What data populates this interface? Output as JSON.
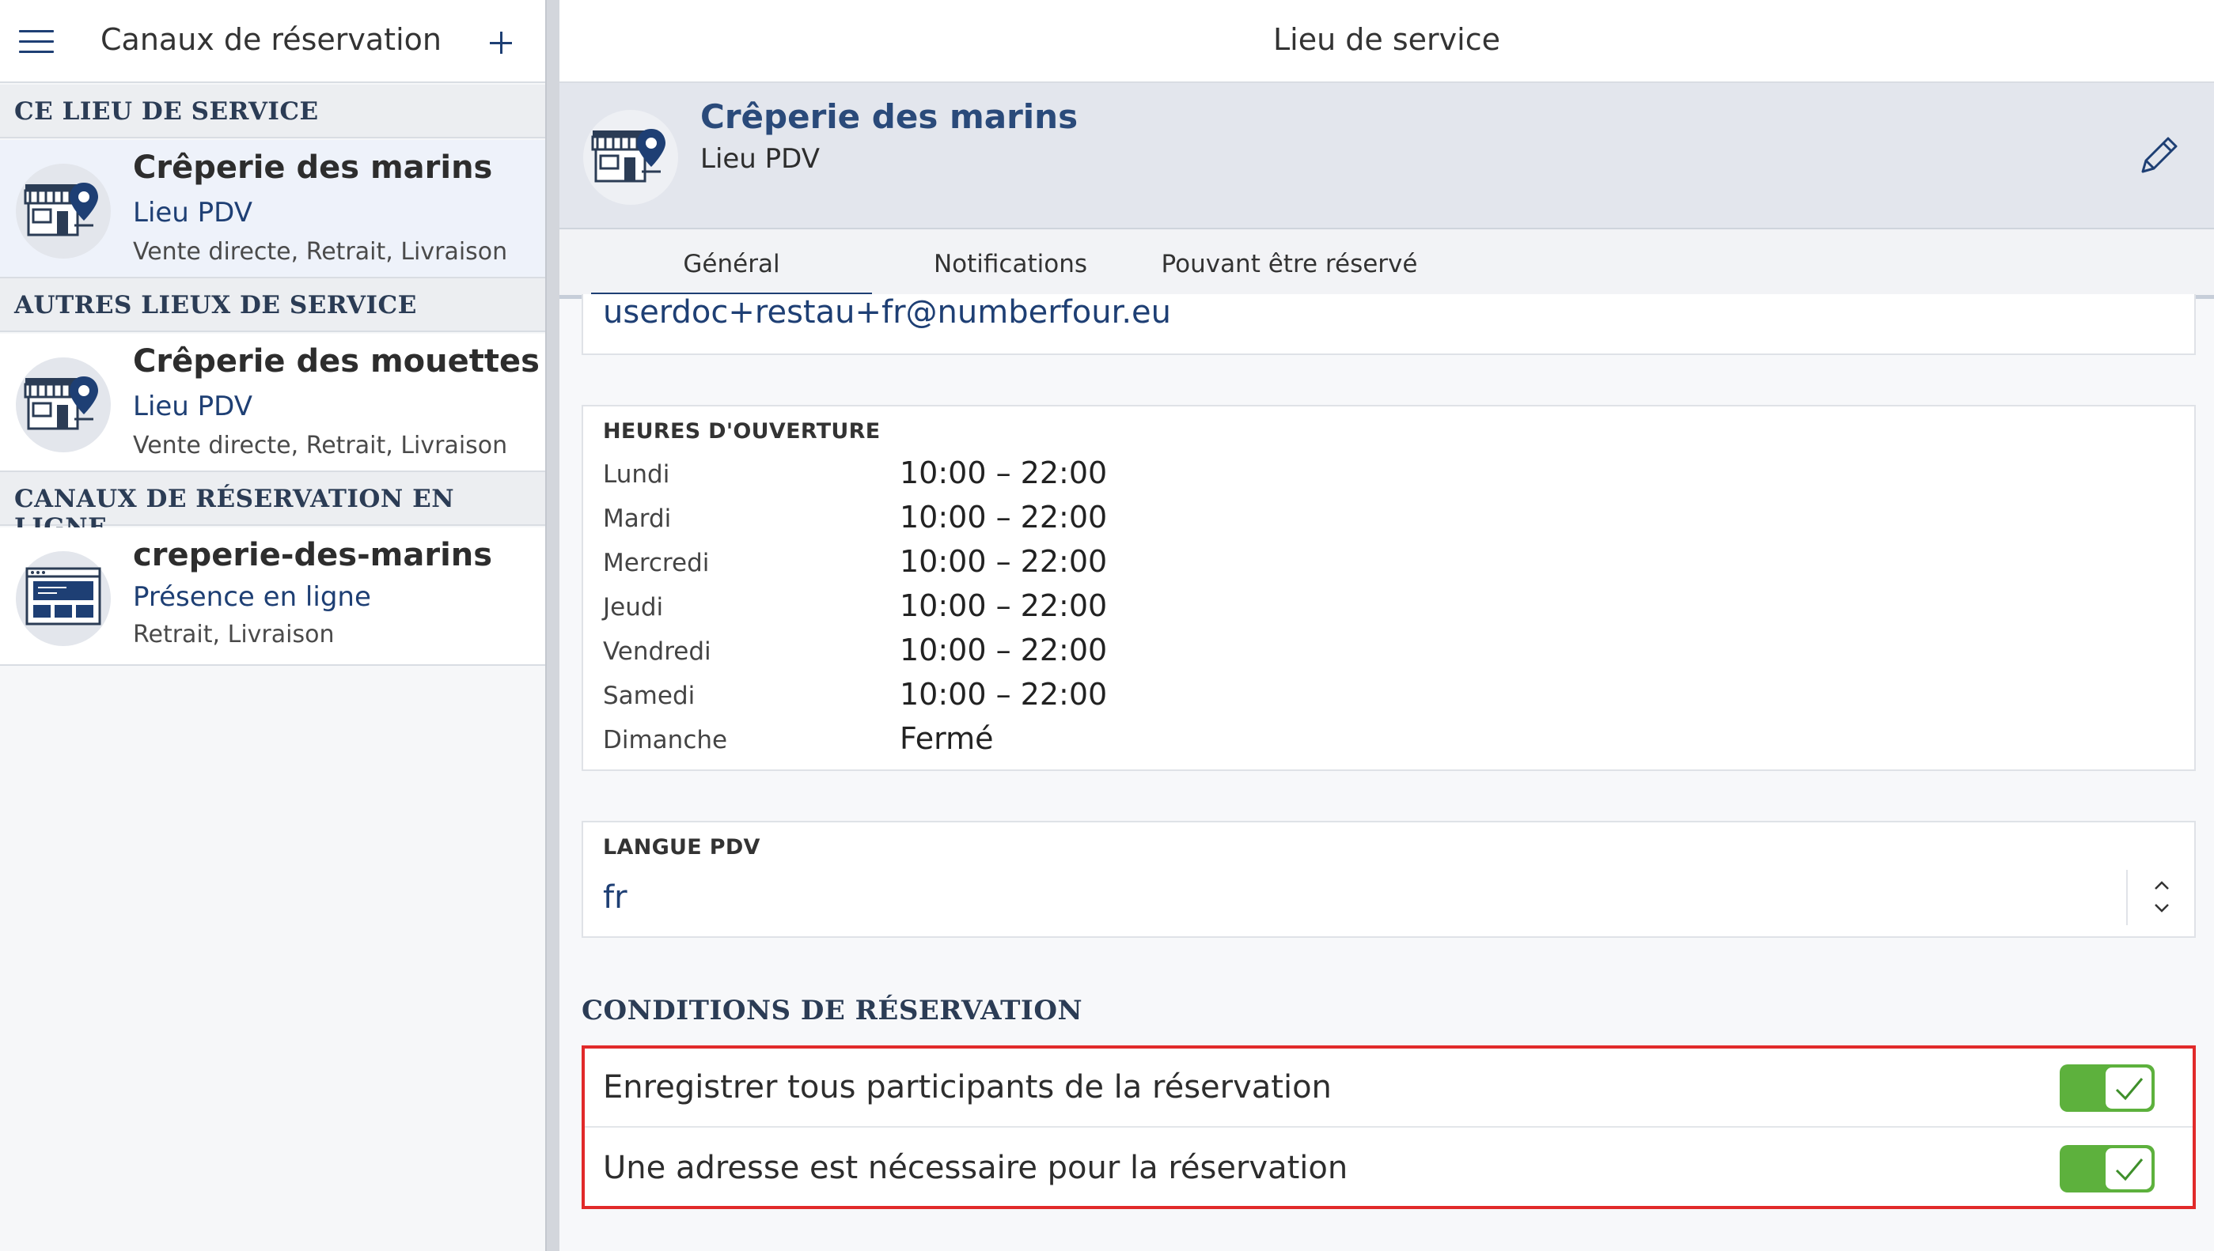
{
  "left_pane": {
    "title": "Canaux de réservation",
    "sections": [
      {
        "heading": "CE LIEU DE SERVICE",
        "items": [
          {
            "title": "Crêperie des marins",
            "subtitle": "Lieu PDV",
            "details": "Vente directe, Retrait, Livraison",
            "icon": "shop-location-icon",
            "selected": true
          }
        ]
      },
      {
        "heading": "AUTRES LIEUX DE SERVICE",
        "items": [
          {
            "title": "Crêperie des mouettes",
            "subtitle": "Lieu PDV",
            "details": "Vente directe, Retrait, Livraison",
            "icon": "shop-location-icon",
            "selected": false
          }
        ]
      },
      {
        "heading": "CANAUX DE RÉSERVATION EN LIGNE",
        "items": [
          {
            "title": "creperie-des-marins",
            "subtitle": "Présence en ligne",
            "details": "Retrait, Livraison",
            "icon": "browser-window-icon",
            "selected": false
          }
        ]
      }
    ]
  },
  "right_pane": {
    "title": "Lieu de service",
    "entity": {
      "title": "Crêperie des marins",
      "subtitle": "Lieu PDV"
    },
    "tabs": [
      {
        "label": "Général",
        "active": true
      },
      {
        "label": "Notifications",
        "active": false
      },
      {
        "label": "Pouvant être réservé",
        "active": false
      }
    ],
    "email": "userdoc+restau+fr@numberfour.eu",
    "hours": {
      "label": "HEURES D'OUVERTURE",
      "days": [
        {
          "day": "Lundi",
          "time": "10:00 – 22:00"
        },
        {
          "day": "Mardi",
          "time": "10:00 – 22:00"
        },
        {
          "day": "Mercredi",
          "time": "10:00 – 22:00"
        },
        {
          "day": "Jeudi",
          "time": "10:00 – 22:00"
        },
        {
          "day": "Vendredi",
          "time": "10:00 – 22:00"
        },
        {
          "day": "Samedi",
          "time": "10:00 – 22:00"
        },
        {
          "day": "Dimanche",
          "time": "Fermé"
        }
      ]
    },
    "language": {
      "label": "LANGUE PDV",
      "value": "fr"
    },
    "conditions": {
      "heading": "CONDITIONS DE RÉSERVATION",
      "items": [
        {
          "label": "Enregistrer tous participants de la réservation",
          "enabled": true
        },
        {
          "label": "Une adresse est nécessaire pour la réservation",
          "enabled": true
        }
      ]
    }
  },
  "colors": {
    "brand": "#1e3f74",
    "toggle_on": "#5db13d",
    "highlight_border": "#e12a2a"
  }
}
